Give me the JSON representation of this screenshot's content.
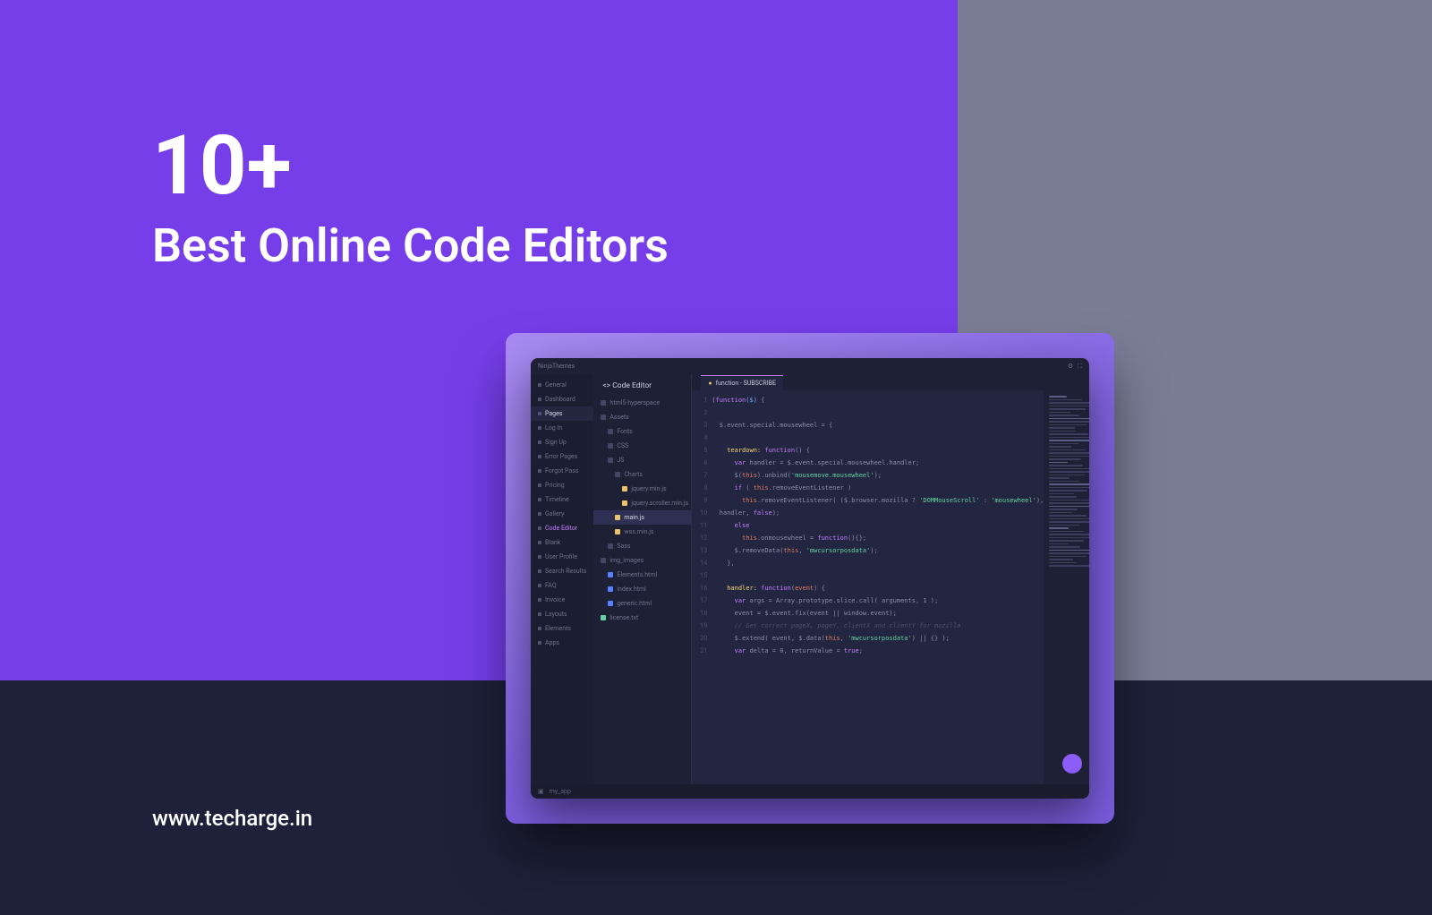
{
  "headline": {
    "line1": "10+",
    "line2": "Best Online Code Editors"
  },
  "website": "www.techarge.in",
  "editor": {
    "brand": "NinjaThemes",
    "panel_title": "Code Editor",
    "active_file_tab": "function - SUBSCRIBE",
    "footer_label": "my_app",
    "sidebar": [
      {
        "label": "General"
      },
      {
        "label": "Dashboard"
      },
      {
        "label": "Pages",
        "active": true
      },
      {
        "label": "Log In"
      },
      {
        "label": "Sign Up"
      },
      {
        "label": "Error Pages"
      },
      {
        "label": "Forgot Pass"
      },
      {
        "label": "Pricing"
      },
      {
        "label": "Timeline"
      },
      {
        "label": "Gallery"
      },
      {
        "label": "Code Editor",
        "hl": true
      },
      {
        "label": "Blank"
      },
      {
        "label": "User Profile"
      },
      {
        "label": "Search Results"
      },
      {
        "label": "FAQ"
      },
      {
        "label": "Invoice"
      },
      {
        "label": "Layouts"
      },
      {
        "label": "Elements"
      },
      {
        "label": "Apps"
      }
    ],
    "filetree": [
      {
        "label": "html5-hyperspace",
        "depth": 0,
        "icon": ""
      },
      {
        "label": "Assets",
        "depth": 0,
        "icon": ""
      },
      {
        "label": "Fonts",
        "depth": 1,
        "icon": ""
      },
      {
        "label": "CSS",
        "depth": 1,
        "icon": ""
      },
      {
        "label": "JS",
        "depth": 1,
        "icon": ""
      },
      {
        "label": "Charts",
        "depth": 2,
        "icon": ""
      },
      {
        "label": "jquery.min.js",
        "depth": 3,
        "icon": "yellow"
      },
      {
        "label": "jquery.scroller.min.js",
        "depth": 3,
        "icon": "yellow"
      },
      {
        "label": "main.js",
        "depth": 2,
        "icon": "yellow",
        "selected": true
      },
      {
        "label": "wss.min.js",
        "depth": 2,
        "icon": "yellow"
      },
      {
        "label": "Sass",
        "depth": 1,
        "icon": ""
      },
      {
        "label": "img_images",
        "depth": 0,
        "icon": ""
      },
      {
        "label": "Elements.html",
        "depth": 1,
        "icon": "blue"
      },
      {
        "label": "index.html",
        "depth": 1,
        "icon": "blue"
      },
      {
        "label": "generic.html",
        "depth": 1,
        "icon": "blue"
      },
      {
        "label": "license.txt",
        "depth": 0,
        "icon": "green"
      }
    ],
    "code_lines": [
      {
        "n": 1,
        "html": "<span class='t-kw'>(function</span><span class='t-fn'>($)</span> {"
      },
      {
        "n": 2,
        "html": ""
      },
      {
        "n": 3,
        "html": "  $.event.special.mousewheel = {"
      },
      {
        "n": 4,
        "html": ""
      },
      {
        "n": 5,
        "html": "    <span class='t-name'>teardown:</span> <span class='t-kw'>function</span>() {"
      },
      {
        "n": 6,
        "html": "      <span class='t-kw'>var</span> handler = $.event.special.mousewheel.handler;"
      },
      {
        "n": 7,
        "html": "      $(<span class='t-var'>this</span>).unbind(<span class='t-str'>'mousemove.mousewheel'</span>);"
      },
      {
        "n": 8,
        "html": "      <span class='t-kw'>if</span> ( <span class='t-var'>this</span>.removeEventListener )"
      },
      {
        "n": 9,
        "html": "        <span class='t-var'>this</span>.removeEventListener( ($.browser.mozilla ? <span class='t-str'>'DOMMouseScroll'</span> : <span class='t-str'>'mousewheel'</span>),"
      },
      {
        "n": 10,
        "html": "  handler, <span class='t-bool'>false</span>);"
      },
      {
        "n": 11,
        "html": "      <span class='t-kw'>else</span>"
      },
      {
        "n": 12,
        "html": "        <span class='t-var'>this</span>.onmousewheel = <span class='t-kw'>function</span>(){};"
      },
      {
        "n": 13,
        "html": "      $.removeData(<span class='t-var'>this</span>, <span class='t-str'>'mwcursorposdata'</span>);"
      },
      {
        "n": 14,
        "html": "    },"
      },
      {
        "n": 15,
        "html": ""
      },
      {
        "n": 16,
        "html": "    <span class='t-name'>handler:</span> <span class='t-kw'>function</span>(<span class='t-var'>event</span>) {"
      },
      {
        "n": 17,
        "html": "      <span class='t-kw'>var</span> args = Array.prototype.slice.call( arguments, 1 );"
      },
      {
        "n": 18,
        "html": "      event = $.event.fix(event || window.event);"
      },
      {
        "n": 19,
        "html": "      <span class='t-cmt'>// Get correct pageX, pageY, clientX and clientY for mozilla</span>"
      },
      {
        "n": 20,
        "html": "      $.extend( event, $.data(<span class='t-var'>this</span>, <span class='t-str'>'mwcursorposdata'</span>) || {} );"
      },
      {
        "n": 21,
        "html": "      <span class='t-kw'>var</span> delta = 0, returnValue = <span class='t-bool'>true</span>;"
      }
    ]
  }
}
